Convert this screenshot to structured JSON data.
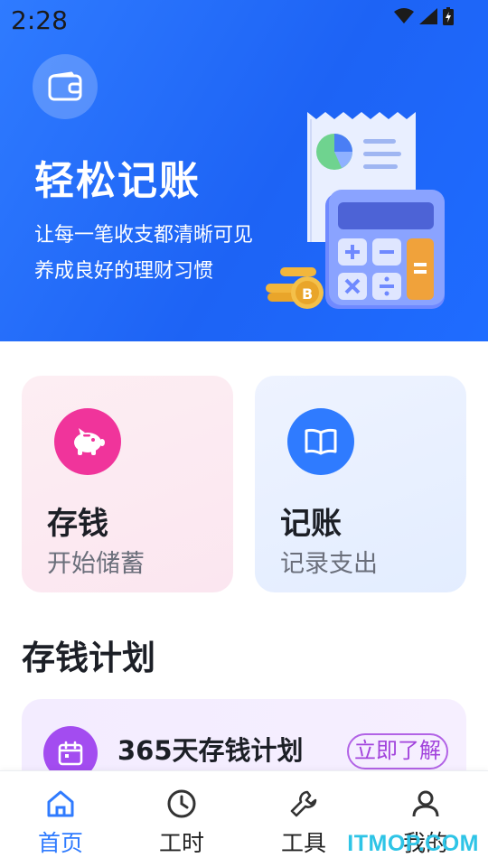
{
  "status_bar": {
    "time": "2:28",
    "icons": [
      "wifi-icon",
      "signal-icon",
      "battery-icon"
    ]
  },
  "hero": {
    "icon": "wallet-icon",
    "title": "轻松记账",
    "subtitle_line1": "让每一笔收支都清晰可见",
    "subtitle_line2": "养成良好的理财习惯",
    "illustration": "calculator-receipt-coins"
  },
  "cards": [
    {
      "icon": "piggy-bank-icon",
      "title": "存钱",
      "subtitle": "开始储蓄",
      "color": "#f0349b"
    },
    {
      "icon": "book-icon",
      "title": "记账",
      "subtitle": "记录支出",
      "color": "#2f7bff"
    }
  ],
  "section": {
    "title": "存钱计划"
  },
  "plan": {
    "icon": "calendar-icon",
    "title": "365天存钱计划",
    "button": "立即了解",
    "color": "#a34cf0"
  },
  "tabbar": {
    "active": "首页",
    "items": [
      {
        "label": "首页",
        "icon": "home-icon"
      },
      {
        "label": "工时",
        "icon": "clock-icon"
      },
      {
        "label": "工具",
        "icon": "wrench-icon"
      },
      {
        "label": "我的",
        "icon": "user-icon"
      }
    ]
  },
  "watermark": "ITMOP.COM",
  "colors": {
    "primary": "#2f7bff",
    "pink": "#f0349b",
    "purple": "#a34cf0"
  }
}
